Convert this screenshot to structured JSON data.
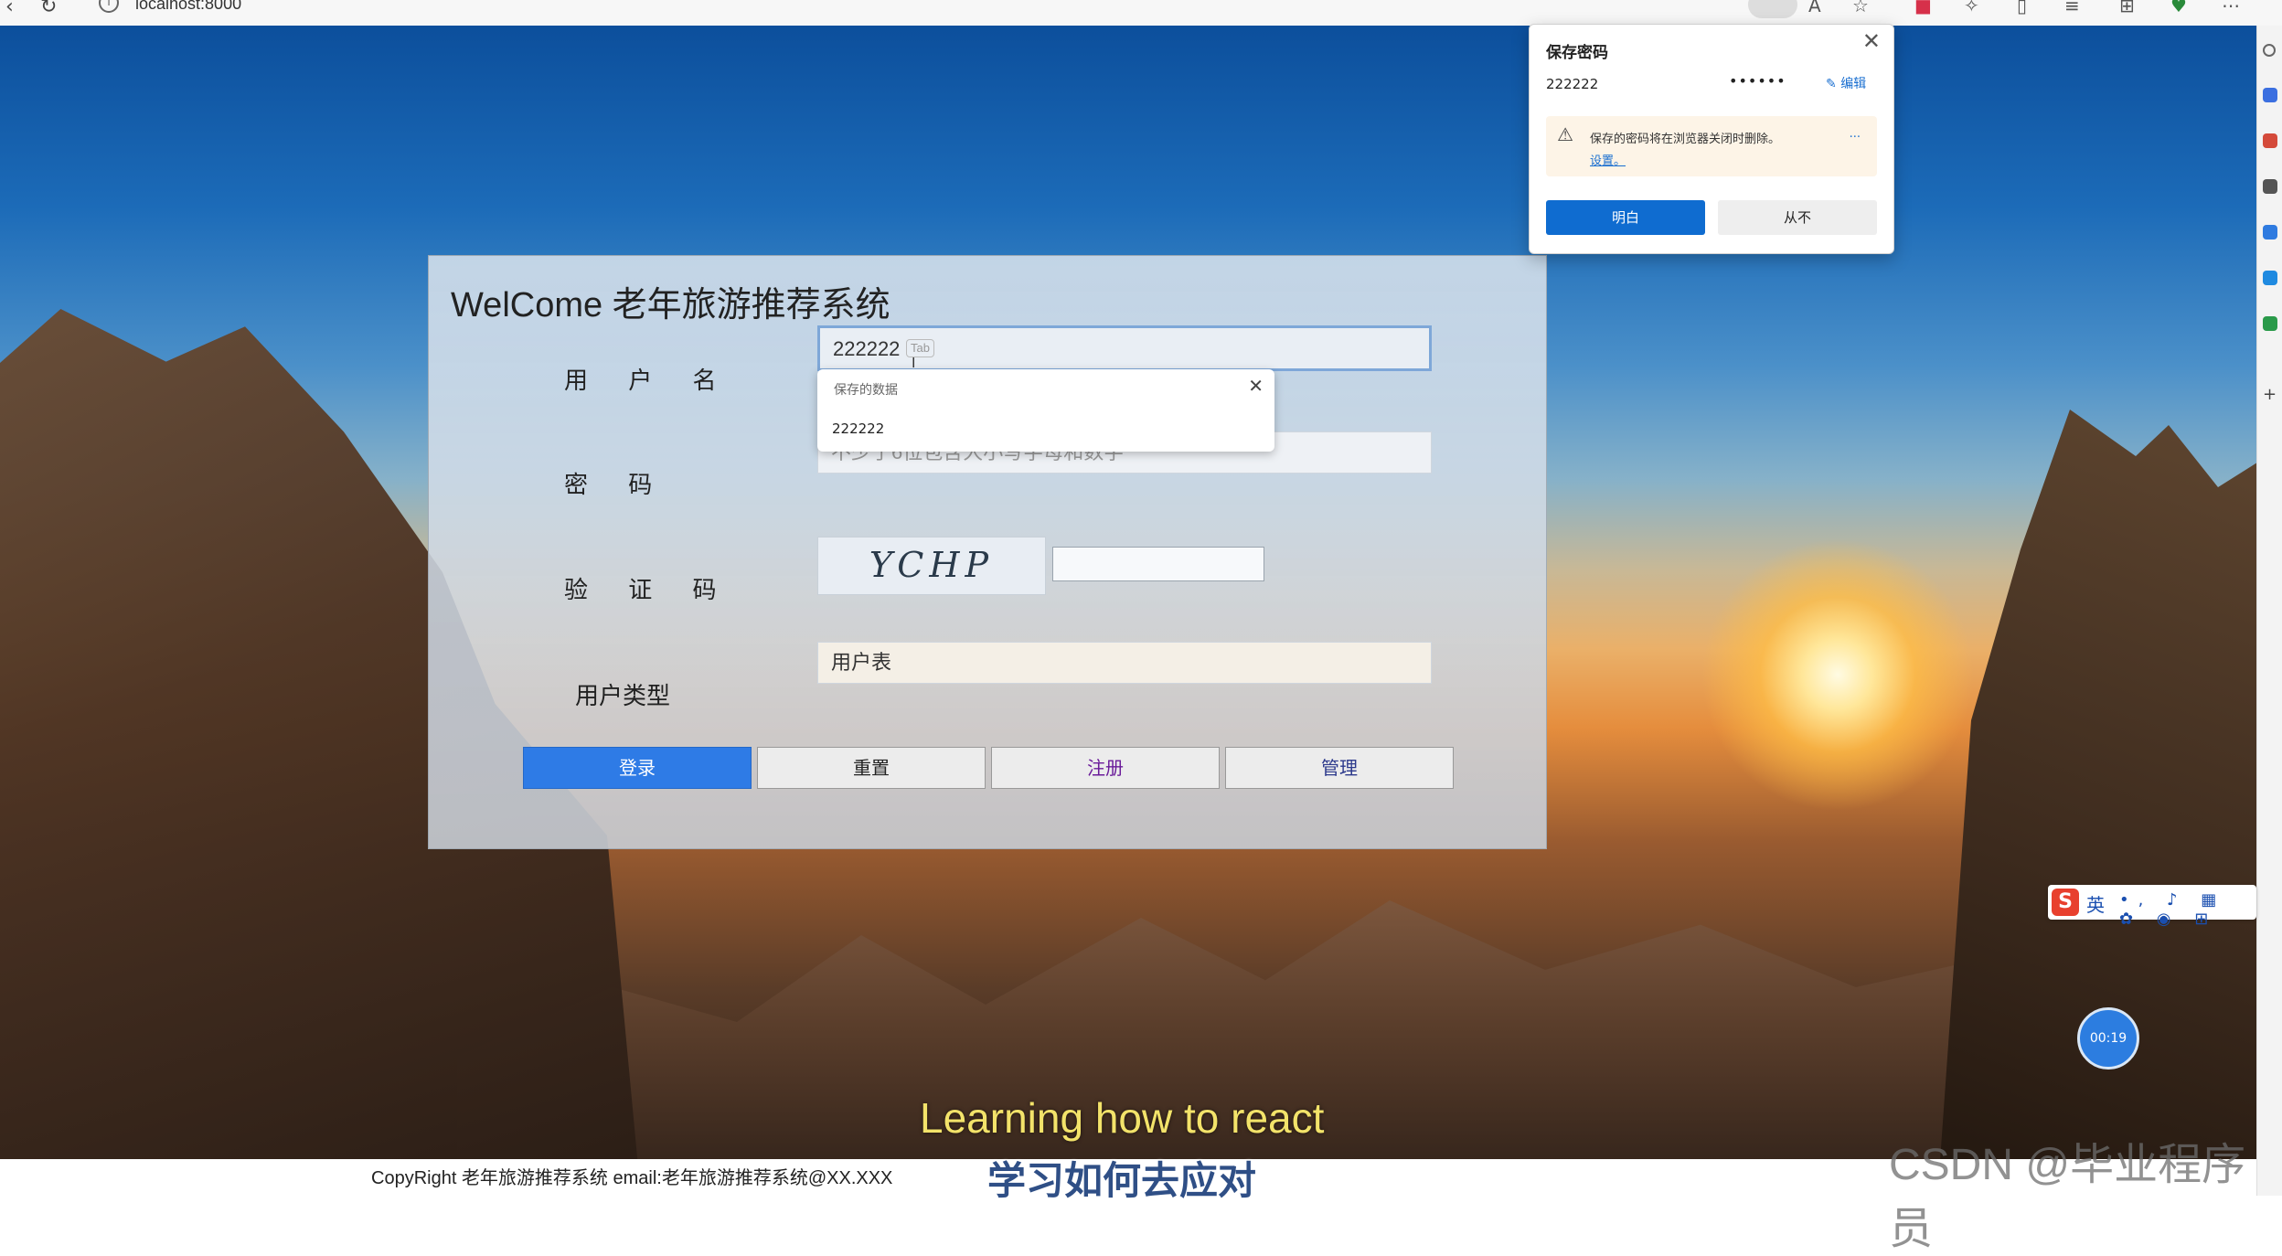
{
  "browser": {
    "url": "localhost:8000"
  },
  "login": {
    "title": "WelCome 老年旅游推荐系统",
    "username_label": "用 户 名",
    "username_value": "222222",
    "tab_hint": "Tab",
    "password_label": "密    码",
    "password_placeholder": "不少于6位包含大小写字母和数字",
    "captcha_label": "验 证 码",
    "captcha_text": "YCHP",
    "captcha_input_value": "",
    "usertype_label": "用户类型",
    "usertype_value": "用户表",
    "buttons": {
      "login": "登录",
      "reset": "重置",
      "register": "注册",
      "admin": "管理"
    }
  },
  "autocomplete": {
    "title": "保存的数据",
    "item": "222222"
  },
  "password_popup": {
    "title": "保存密码",
    "username": "222222",
    "password_mask": "••••••",
    "edit_label": "编辑",
    "warning_text": "保存的密码将在浏览器关闭时删除。",
    "warning_link": "设置。",
    "warning_more": "...",
    "ok_button": "明白",
    "never_button": "从不"
  },
  "footer": {
    "copyright": "CopyRight 老年旅游推荐系统 email:老年旅游推荐系统@XX.XXX"
  },
  "overlay": {
    "subtitle_en": "Learning how to react",
    "subtitle_zh": "学习如何去应对",
    "watermark": "CSDN @毕业程序员",
    "timer": "00:19",
    "ime_logo": "S",
    "ime_lang": "英"
  },
  "colors": {
    "primary_button": "#2e7be6",
    "popup_button": "#0f6cd0",
    "subtitle_en": "#f3e36a"
  }
}
